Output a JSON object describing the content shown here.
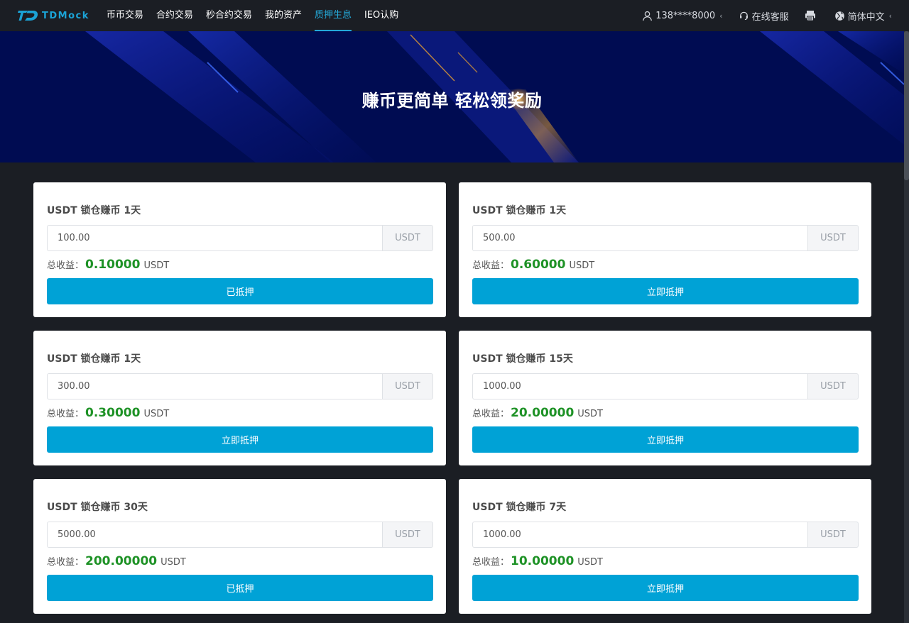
{
  "header": {
    "logo_text": "TDMock",
    "nav": [
      {
        "label": "币币交易",
        "active": false
      },
      {
        "label": "合约交易",
        "active": false
      },
      {
        "label": "秒合约交易",
        "active": false
      },
      {
        "label": "我的资产",
        "active": false
      },
      {
        "label": "质押生息",
        "active": true
      },
      {
        "label": "IEO认购",
        "active": false
      }
    ],
    "user_phone": "138****8000",
    "support_label": "在线客服",
    "language_label": "简体中文",
    "caret": "‹"
  },
  "banner": {
    "title": "赚币更简单 轻松领奖励"
  },
  "colors": {
    "accent": "#00a2d6",
    "profit_green": "#1e9226",
    "banner_bg": "#000c52",
    "page_bg": "#1b1e24"
  },
  "cards": [
    {
      "title": "USDT 锁仓赚币 1天",
      "amount": "100.00",
      "unit": "USDT",
      "profit_label": "总收益：",
      "profit": "0.10000",
      "profit_unit": "USDT",
      "button": "已抵押"
    },
    {
      "title": "USDT 锁仓赚币 1天",
      "amount": "500.00",
      "unit": "USDT",
      "profit_label": "总收益：",
      "profit": "0.60000",
      "profit_unit": "USDT",
      "button": "立即抵押"
    },
    {
      "title": "USDT 锁仓赚币 1天",
      "amount": "300.00",
      "unit": "USDT",
      "profit_label": "总收益：",
      "profit": "0.30000",
      "profit_unit": "USDT",
      "button": "立即抵押"
    },
    {
      "title": "USDT 锁仓赚币 15天",
      "amount": "1000.00",
      "unit": "USDT",
      "profit_label": "总收益：",
      "profit": "20.00000",
      "profit_unit": "USDT",
      "button": "立即抵押"
    },
    {
      "title": "USDT 锁仓赚币 30天",
      "amount": "5000.00",
      "unit": "USDT",
      "profit_label": "总收益：",
      "profit": "200.00000",
      "profit_unit": "USDT",
      "button": "已抵押"
    },
    {
      "title": "USDT 锁仓赚币 7天",
      "amount": "1000.00",
      "unit": "USDT",
      "profit_label": "总收益：",
      "profit": "10.00000",
      "profit_unit": "USDT",
      "button": "立即抵押"
    }
  ]
}
